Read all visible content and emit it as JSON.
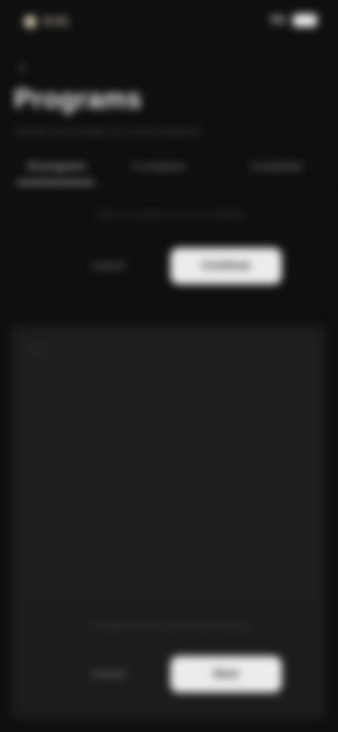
{
  "status": {
    "time": "9:41",
    "right_label": "5G"
  },
  "header": {
    "back_icon": "chevron-left-icon",
    "title": "Programs",
    "subtitle": "Browse and manage your saved programs"
  },
  "tabs": [
    {
      "label": "All programs",
      "active": true
    },
    {
      "label": "In progress",
      "active": false
    },
    {
      "label": "Completed",
      "active": false
    }
  ],
  "top_panel": {
    "message": "Select a program to see its details",
    "secondary_label": "Cancel",
    "primary_label": "Continue"
  },
  "bottom_panel": {
    "message": "Changes will be saved automatically",
    "secondary_label": "Cancel",
    "primary_label": "Save"
  },
  "colors": {
    "background": "#0f0f10",
    "card": "#1c1c1d",
    "primary_button": "#ececec",
    "accent": "#cfc6aa"
  }
}
